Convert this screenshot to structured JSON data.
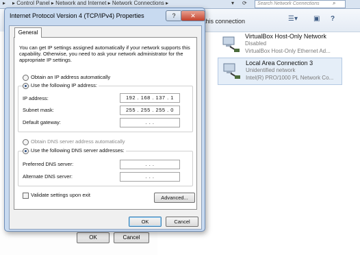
{
  "background": {
    "breadcrumb": "▸ Control Panel ▸ Network and Internet ▸ Network Connections ▸",
    "search_placeholder": "Search Network Connections",
    "toolbar_text": "this connection",
    "connections": [
      {
        "name": "VirtualBox Host-Only Network",
        "status": "Disabled",
        "device": "VirtualBox Host-Only Ethernet Ad..."
      },
      {
        "name": "Local Area Connection 3",
        "status": "Unidentified network",
        "device": "Intel(R) PRO/1000 PL Network Co..."
      }
    ],
    "dialog_buttons": {
      "ok": "OK",
      "cancel": "Cancel"
    }
  },
  "dialog": {
    "title": "Internet Protocol Version 4 (TCP/IPv4) Properties",
    "help_label": "?",
    "close_label": "✕",
    "tab_general": "General",
    "intro": "You can get IP settings assigned automatically if your network supports this capability. Otherwise, you need to ask your network administrator for the appropriate IP settings.",
    "obtain_ip_auto": "Obtain an IP address automatically",
    "use_following_ip": "Use the following IP address:",
    "ip_address_label": "IP address:",
    "ip_address_value": "192 . 168 . 137 .  1",
    "subnet_label": "Subnet mask:",
    "subnet_value": "255 . 255 . 255 .  0",
    "gateway_label": "Default gateway:",
    "gateway_value": ".      .      .",
    "obtain_dns_auto": "Obtain DNS server address automatically",
    "use_following_dns": "Use the following DNS server addresses:",
    "preferred_dns_label": "Preferred DNS server:",
    "preferred_dns_value": ".      .      .",
    "alternate_dns_label": "Alternate DNS server:",
    "alternate_dns_value": ".      .      .",
    "validate_label": "Validate settings upon exit",
    "advanced_label": "Advanced...",
    "ok_label": "OK",
    "cancel_label": "Cancel"
  }
}
